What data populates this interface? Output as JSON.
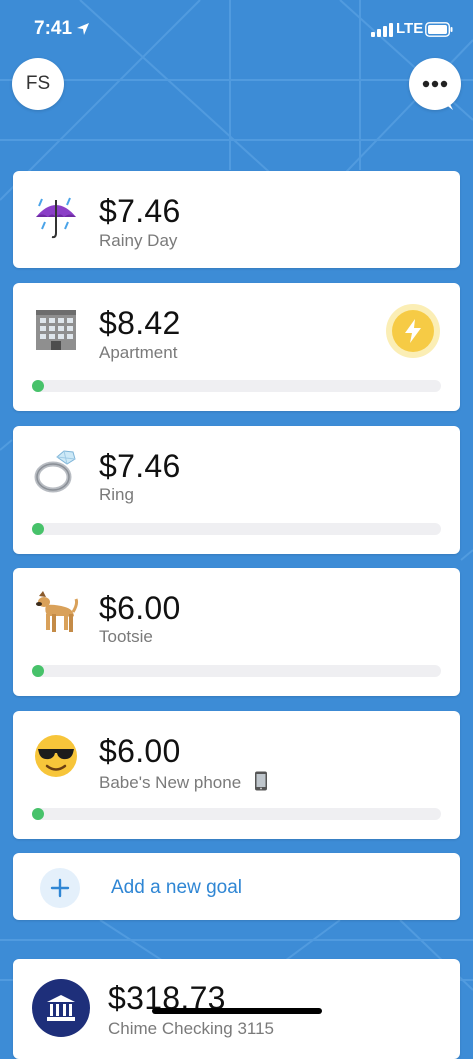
{
  "status_bar": {
    "time": "7:41",
    "network": "LTE"
  },
  "header": {
    "avatar_initials": "FS"
  },
  "goals": [
    {
      "emoji": "umbrella-with-rain-icon",
      "amount": "$7.46",
      "name": "Rainy Day",
      "progress": null
    },
    {
      "emoji": "office-building-icon",
      "amount": "$8.42",
      "name": "Apartment",
      "progress": 0.01,
      "boost": true
    },
    {
      "emoji": "ring-icon",
      "amount": "$7.46",
      "name": "Ring",
      "progress": 0.01
    },
    {
      "emoji": "dog-icon",
      "amount": "$6.00",
      "name": "Tootsie",
      "progress": 0.01
    },
    {
      "emoji": "sunglasses-face-icon",
      "amount": "$6.00",
      "name": "Babe's New phone",
      "name_emoji": "mobile-phone-icon",
      "progress": 0.01
    }
  ],
  "add_goal": {
    "label": "Add a new goal"
  },
  "account": {
    "amount": "$318.73",
    "name": "Chime Checking 3115"
  },
  "colors": {
    "background": "#3d8cd6",
    "progress": "#47c26a",
    "boost": "#f6cb45",
    "link": "#2f86d4",
    "bank": "#1e2f7a"
  }
}
